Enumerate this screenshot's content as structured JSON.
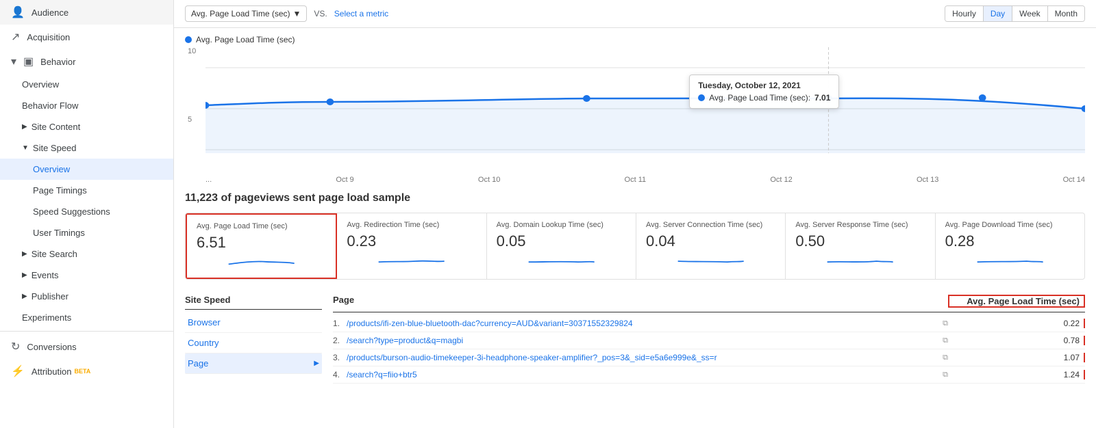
{
  "sidebar": {
    "items": [
      {
        "id": "audience",
        "label": "Audience",
        "icon": "👤",
        "indent": 0,
        "expandable": false
      },
      {
        "id": "acquisition",
        "label": "Acquisition",
        "icon": "↗",
        "indent": 0,
        "expandable": false
      },
      {
        "id": "behavior",
        "label": "Behavior",
        "icon": "▣",
        "indent": 0,
        "expandable": true,
        "expanded": true
      },
      {
        "id": "overview",
        "label": "Overview",
        "indent": 1
      },
      {
        "id": "behavior-flow",
        "label": "Behavior Flow",
        "indent": 1
      },
      {
        "id": "site-content",
        "label": "Site Content",
        "indent": 1,
        "expandable": true
      },
      {
        "id": "site-speed",
        "label": "Site Speed",
        "indent": 1,
        "expandable": true,
        "expanded": true
      },
      {
        "id": "ss-overview",
        "label": "Overview",
        "indent": 2,
        "active": true
      },
      {
        "id": "page-timings",
        "label": "Page Timings",
        "indent": 2
      },
      {
        "id": "speed-suggestions",
        "label": "Speed Suggestions",
        "indent": 2
      },
      {
        "id": "user-timings",
        "label": "User Timings",
        "indent": 2
      },
      {
        "id": "site-search",
        "label": "Site Search",
        "indent": 1,
        "expandable": true
      },
      {
        "id": "events",
        "label": "Events",
        "indent": 1,
        "expandable": true
      },
      {
        "id": "publisher",
        "label": "Publisher",
        "indent": 1,
        "expandable": true
      },
      {
        "id": "experiments",
        "label": "Experiments",
        "indent": 1
      },
      {
        "id": "conversions",
        "label": "Conversions",
        "icon": "↻",
        "indent": 0,
        "expandable": true
      },
      {
        "id": "attribution",
        "label": "Attribution",
        "indent": 0,
        "beta": true
      }
    ]
  },
  "topbar": {
    "metric_dropdown": "Avg. Page Load Time (sec)",
    "vs_label": "VS.",
    "select_metric_label": "Select a metric",
    "time_buttons": [
      "Hourly",
      "Day",
      "Week",
      "Month"
    ],
    "active_time_button": "Day"
  },
  "chart": {
    "legend_label": "Avg. Page Load Time (sec)",
    "y_labels": [
      "10",
      "5"
    ],
    "x_labels": [
      "...",
      "Oct 9",
      "Oct 10",
      "Oct 11",
      "Oct 12",
      "Oct 13",
      "Oct 14"
    ],
    "tooltip": {
      "title": "Tuesday, October 12, 2021",
      "label": "Avg. Page Load Time (sec):",
      "value": "7.01"
    },
    "data_points": [
      {
        "x": 0,
        "y": 0.52
      },
      {
        "x": 0.14,
        "y": 0.48
      },
      {
        "x": 0.28,
        "y": 0.45
      },
      {
        "x": 0.42,
        "y": 0.44
      },
      {
        "x": 0.57,
        "y": 0.45
      },
      {
        "x": 0.71,
        "y": 0.42
      },
      {
        "x": 0.85,
        "y": 0.43
      },
      {
        "x": 1.0,
        "y": 0.5
      }
    ]
  },
  "stats": {
    "title": "11,223 of pageviews sent page load sample",
    "cards": [
      {
        "label": "Avg. Page Load Time (sec)",
        "value": "6.51",
        "highlighted": true
      },
      {
        "label": "Avg. Redirection Time (sec)",
        "value": "0.23",
        "highlighted": false
      },
      {
        "label": "Avg. Domain Lookup Time (sec)",
        "value": "0.05",
        "highlighted": false
      },
      {
        "label": "Avg. Server Connection Time (sec)",
        "value": "0.04",
        "highlighted": false
      },
      {
        "label": "Avg. Server Response Time (sec)",
        "value": "0.50",
        "highlighted": false
      },
      {
        "label": "Avg. Page Download Time (sec)",
        "value": "0.28",
        "highlighted": false
      }
    ]
  },
  "left_table": {
    "header": "Site Speed",
    "items": [
      {
        "label": "Browser",
        "active": false
      },
      {
        "label": "Country",
        "active": false
      },
      {
        "label": "Page",
        "active": true,
        "has_chevron": true
      }
    ]
  },
  "right_table": {
    "col_page": "Page",
    "col_value": "Avg. Page Load Time (sec)",
    "rows": [
      {
        "num": "1.",
        "link": "/products/ifi-zen-blue-bluetooth-dac?currency=AUD&variant=30371552329824",
        "value": "0.22"
      },
      {
        "num": "2.",
        "link": "/search?type=product&q=magbi",
        "value": "0.78"
      },
      {
        "num": "3.",
        "link": "/products/burson-audio-timekeeper-3i-headphone-speaker-amplifier?_pos=3&_sid=e5a6e999e&_ss=r",
        "value": "1.07"
      },
      {
        "num": "4.",
        "link": "/search?q=fiio+btr5",
        "value": "1.24"
      }
    ]
  }
}
